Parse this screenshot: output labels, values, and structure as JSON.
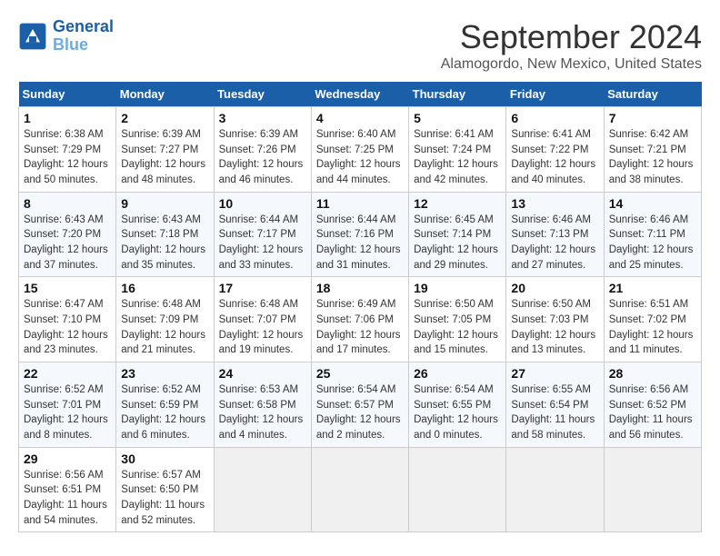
{
  "header": {
    "logo_line1": "General",
    "logo_line2": "Blue",
    "month_year": "September 2024",
    "location": "Alamogordo, New Mexico, United States"
  },
  "weekdays": [
    "Sunday",
    "Monday",
    "Tuesday",
    "Wednesday",
    "Thursday",
    "Friday",
    "Saturday"
  ],
  "weeks": [
    [
      {
        "day": "1",
        "info": "Sunrise: 6:38 AM\nSunset: 7:29 PM\nDaylight: 12 hours\nand 50 minutes."
      },
      {
        "day": "2",
        "info": "Sunrise: 6:39 AM\nSunset: 7:27 PM\nDaylight: 12 hours\nand 48 minutes."
      },
      {
        "day": "3",
        "info": "Sunrise: 6:39 AM\nSunset: 7:26 PM\nDaylight: 12 hours\nand 46 minutes."
      },
      {
        "day": "4",
        "info": "Sunrise: 6:40 AM\nSunset: 7:25 PM\nDaylight: 12 hours\nand 44 minutes."
      },
      {
        "day": "5",
        "info": "Sunrise: 6:41 AM\nSunset: 7:24 PM\nDaylight: 12 hours\nand 42 minutes."
      },
      {
        "day": "6",
        "info": "Sunrise: 6:41 AM\nSunset: 7:22 PM\nDaylight: 12 hours\nand 40 minutes."
      },
      {
        "day": "7",
        "info": "Sunrise: 6:42 AM\nSunset: 7:21 PM\nDaylight: 12 hours\nand 38 minutes."
      }
    ],
    [
      {
        "day": "8",
        "info": "Sunrise: 6:43 AM\nSunset: 7:20 PM\nDaylight: 12 hours\nand 37 minutes."
      },
      {
        "day": "9",
        "info": "Sunrise: 6:43 AM\nSunset: 7:18 PM\nDaylight: 12 hours\nand 35 minutes."
      },
      {
        "day": "10",
        "info": "Sunrise: 6:44 AM\nSunset: 7:17 PM\nDaylight: 12 hours\nand 33 minutes."
      },
      {
        "day": "11",
        "info": "Sunrise: 6:44 AM\nSunset: 7:16 PM\nDaylight: 12 hours\nand 31 minutes."
      },
      {
        "day": "12",
        "info": "Sunrise: 6:45 AM\nSunset: 7:14 PM\nDaylight: 12 hours\nand 29 minutes."
      },
      {
        "day": "13",
        "info": "Sunrise: 6:46 AM\nSunset: 7:13 PM\nDaylight: 12 hours\nand 27 minutes."
      },
      {
        "day": "14",
        "info": "Sunrise: 6:46 AM\nSunset: 7:11 PM\nDaylight: 12 hours\nand 25 minutes."
      }
    ],
    [
      {
        "day": "15",
        "info": "Sunrise: 6:47 AM\nSunset: 7:10 PM\nDaylight: 12 hours\nand 23 minutes."
      },
      {
        "day": "16",
        "info": "Sunrise: 6:48 AM\nSunset: 7:09 PM\nDaylight: 12 hours\nand 21 minutes."
      },
      {
        "day": "17",
        "info": "Sunrise: 6:48 AM\nSunset: 7:07 PM\nDaylight: 12 hours\nand 19 minutes."
      },
      {
        "day": "18",
        "info": "Sunrise: 6:49 AM\nSunset: 7:06 PM\nDaylight: 12 hours\nand 17 minutes."
      },
      {
        "day": "19",
        "info": "Sunrise: 6:50 AM\nSunset: 7:05 PM\nDaylight: 12 hours\nand 15 minutes."
      },
      {
        "day": "20",
        "info": "Sunrise: 6:50 AM\nSunset: 7:03 PM\nDaylight: 12 hours\nand 13 minutes."
      },
      {
        "day": "21",
        "info": "Sunrise: 6:51 AM\nSunset: 7:02 PM\nDaylight: 12 hours\nand 11 minutes."
      }
    ],
    [
      {
        "day": "22",
        "info": "Sunrise: 6:52 AM\nSunset: 7:01 PM\nDaylight: 12 hours\nand 8 minutes."
      },
      {
        "day": "23",
        "info": "Sunrise: 6:52 AM\nSunset: 6:59 PM\nDaylight: 12 hours\nand 6 minutes."
      },
      {
        "day": "24",
        "info": "Sunrise: 6:53 AM\nSunset: 6:58 PM\nDaylight: 12 hours\nand 4 minutes."
      },
      {
        "day": "25",
        "info": "Sunrise: 6:54 AM\nSunset: 6:57 PM\nDaylight: 12 hours\nand 2 minutes."
      },
      {
        "day": "26",
        "info": "Sunrise: 6:54 AM\nSunset: 6:55 PM\nDaylight: 12 hours\nand 0 minutes."
      },
      {
        "day": "27",
        "info": "Sunrise: 6:55 AM\nSunset: 6:54 PM\nDaylight: 11 hours\nand 58 minutes."
      },
      {
        "day": "28",
        "info": "Sunrise: 6:56 AM\nSunset: 6:52 PM\nDaylight: 11 hours\nand 56 minutes."
      }
    ],
    [
      {
        "day": "29",
        "info": "Sunrise: 6:56 AM\nSunset: 6:51 PM\nDaylight: 11 hours\nand 54 minutes."
      },
      {
        "day": "30",
        "info": "Sunrise: 6:57 AM\nSunset: 6:50 PM\nDaylight: 11 hours\nand 52 minutes."
      },
      {
        "day": "",
        "info": ""
      },
      {
        "day": "",
        "info": ""
      },
      {
        "day": "",
        "info": ""
      },
      {
        "day": "",
        "info": ""
      },
      {
        "day": "",
        "info": ""
      }
    ]
  ]
}
